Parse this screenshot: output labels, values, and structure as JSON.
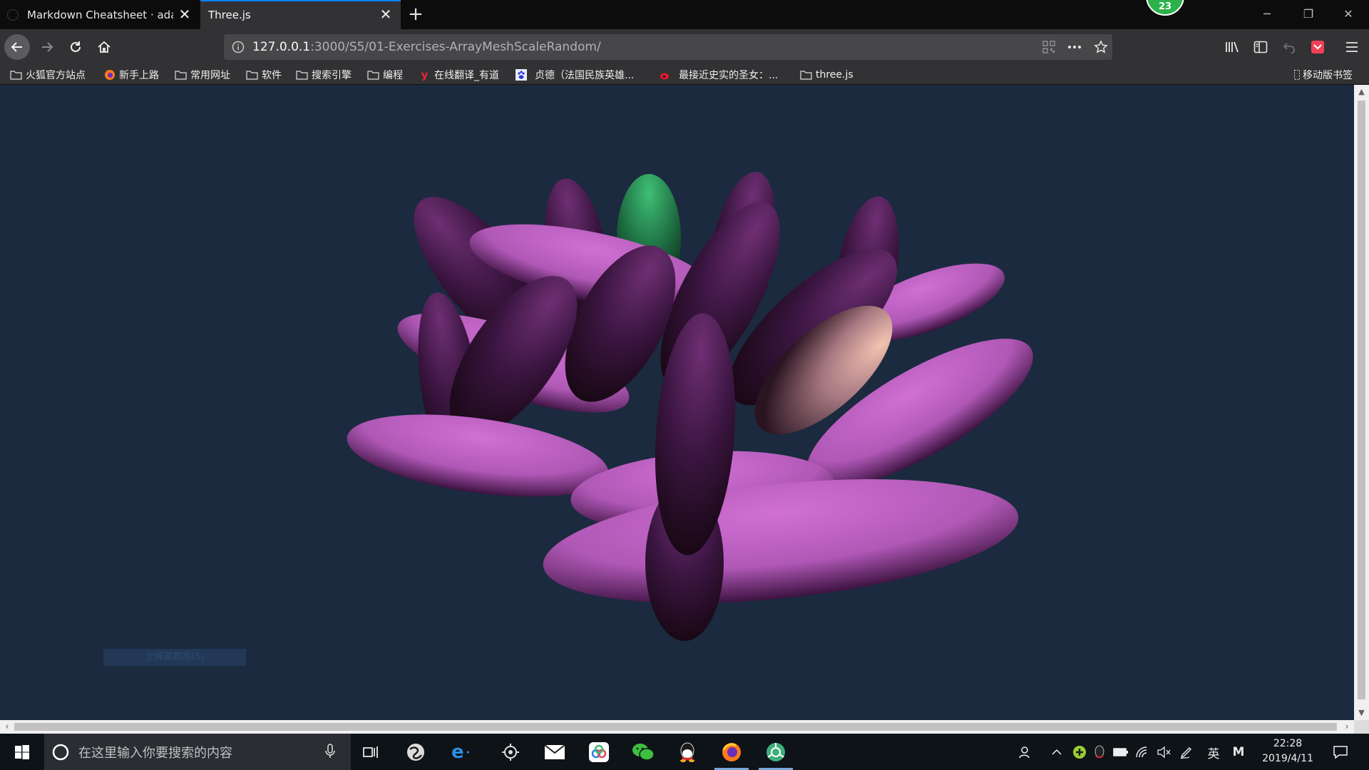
{
  "tabs": [
    {
      "title": "Markdown Cheatsheet · adam-p/markdown-here Wiki",
      "active": false
    },
    {
      "title": "Three.js",
      "active": true
    }
  ],
  "notification_badge": "23",
  "window_controls": [
    "minimize-icon",
    "restore-icon",
    "close-icon"
  ],
  "navigation": {
    "url_host": "127.0.0.1",
    "url_rest": ":3000/S5/01-Exercises-ArrayMeshScaleRandom/"
  },
  "bookmarks": [
    {
      "label": "火狐官方站点",
      "icon": "folder-icon"
    },
    {
      "label": "新手上路",
      "icon": "firefox-icon"
    },
    {
      "label": "常用网址",
      "icon": "folder-icon"
    },
    {
      "label": "软件",
      "icon": "folder-icon"
    },
    {
      "label": "搜索引擎",
      "icon": "folder-icon"
    },
    {
      "label": "编程",
      "icon": "folder-icon"
    },
    {
      "label": "在线翻译_有道",
      "icon": "youdao-icon"
    },
    {
      "label": "贞德（法国民族英雄...",
      "icon": "baidu-icon"
    },
    {
      "label": "最接近史实的圣女：...",
      "icon": "weibo-icon"
    },
    {
      "label": "three.js",
      "icon": "folder-icon"
    }
  ],
  "mobile_bookmarks": "移动版书签",
  "page": {
    "screenshot_button": "全屏幕截图(S)",
    "scene_colors": {
      "background": "#1b2a3e",
      "ellipsoid": "#c05fc2",
      "highlight_green": "#2f9e5e",
      "highlight_peach": "#e4a79a"
    }
  },
  "taskbar": {
    "search_placeholder": "在这里输入你要搜索的内容",
    "apps": [
      "task-view-icon",
      "app-swirl-icon",
      "ie-icon",
      "settings-app-icon",
      "mail-icon",
      "baidu-netdisk-icon",
      "wechat-icon",
      "qq-icon",
      "firefox-icon",
      "chrome-like-icon"
    ],
    "ime": "英",
    "ime_mode": "M",
    "time": "22:28",
    "date": "2019/4/11"
  }
}
